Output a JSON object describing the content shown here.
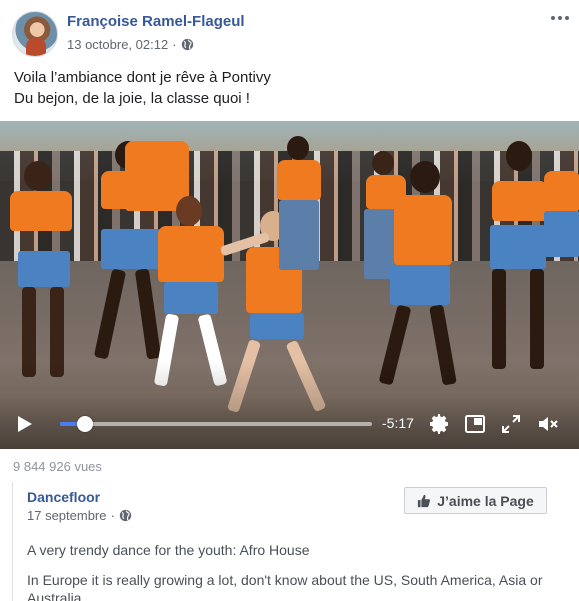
{
  "post": {
    "author": "Françoise Ramel-Flageul",
    "timestamp": "13 octobre, 02:12",
    "privacy_icon": "globe-icon",
    "text_lines": [
      "Voila l’ambiance dont je rêve à Pontivy",
      "Du bejon, de la joie, la classe quoi !"
    ]
  },
  "video": {
    "time_remaining": "-5:17",
    "progress": 0.08,
    "icons": [
      "play-icon",
      "settings-gear-icon",
      "picture-in-picture-icon",
      "fullscreen-icon",
      "muted-speaker-icon"
    ]
  },
  "stats": {
    "views": "9 844 926 vues"
  },
  "shared_page": {
    "name": "Dancefloor",
    "date": "17 septembre",
    "like_button": "J’aime la Page",
    "description_1": "A very trendy dance for the youth: Afro House",
    "description_2": "In Europe it is really growing a lot, don't know about the US, South America, Asia or Australia"
  },
  "colors": {
    "link_blue": "#385898",
    "meta_gray": "#616770",
    "shirt_orange": "#f07a1f",
    "progress_blue": "#4b7cf3"
  }
}
